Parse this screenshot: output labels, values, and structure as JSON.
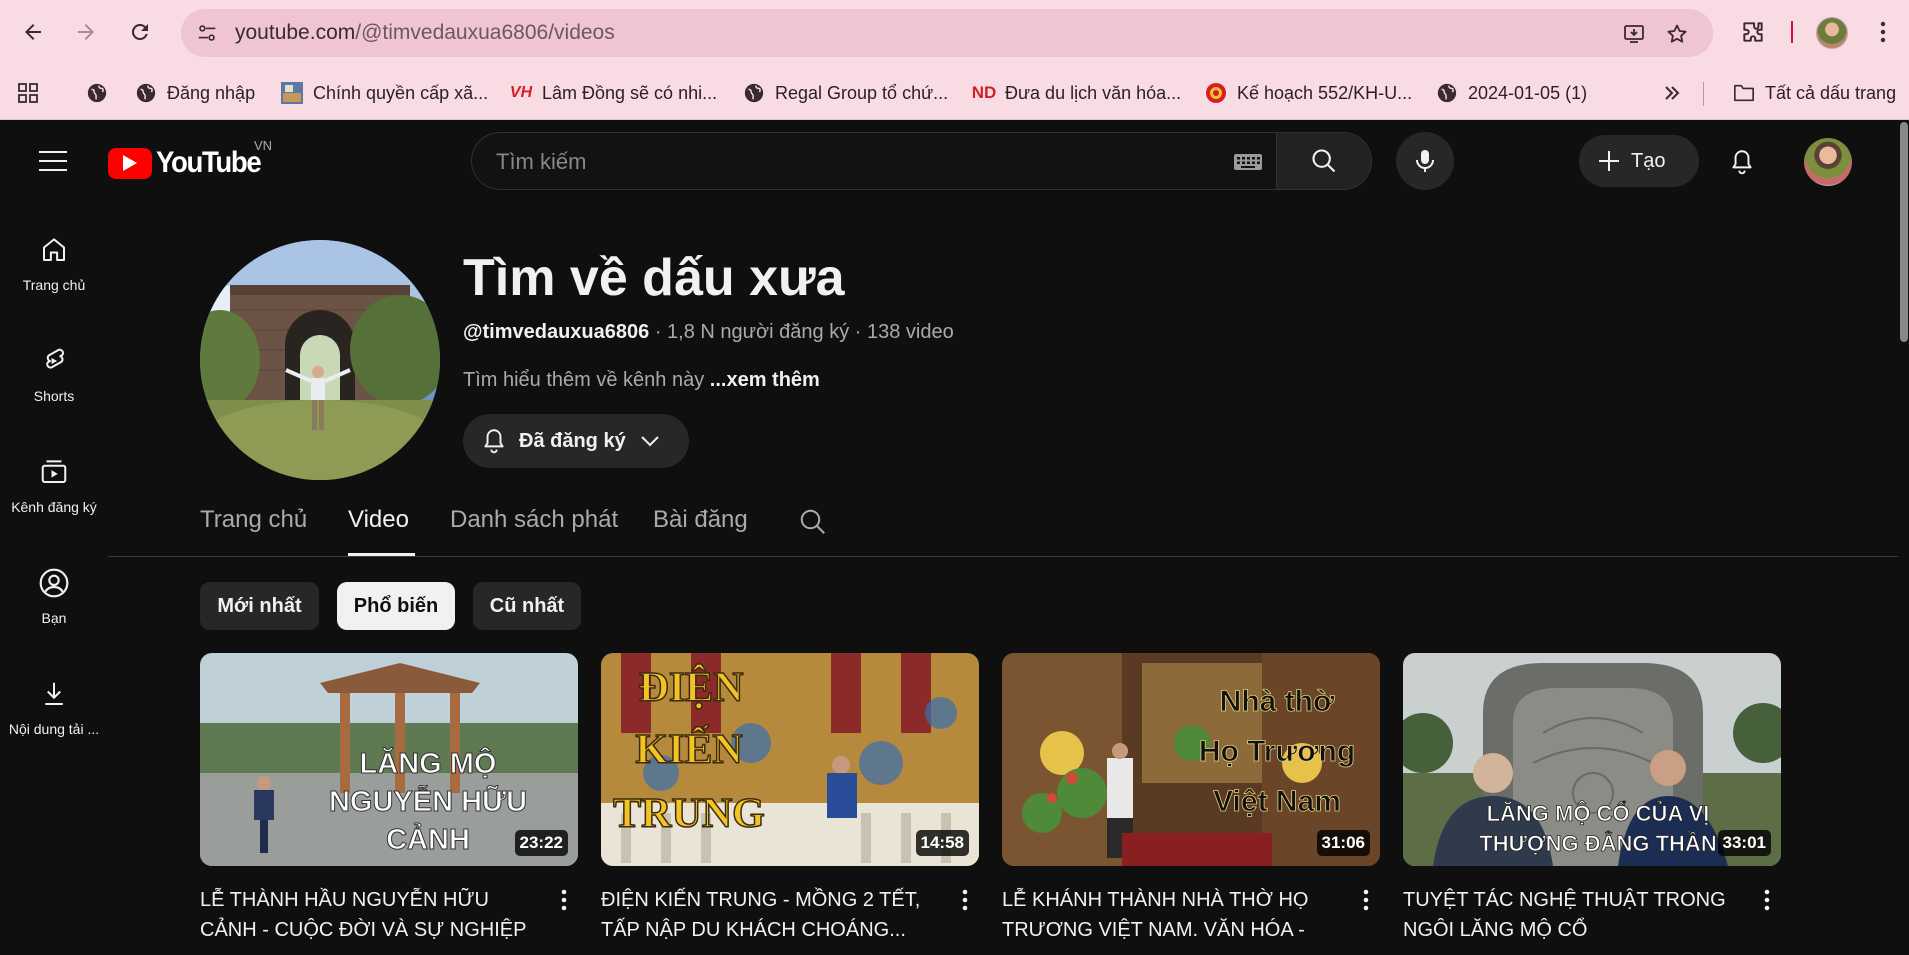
{
  "browser": {
    "url_host": "youtube.com",
    "url_path": "/@timvedauxua6806/videos",
    "bookmarks": [
      {
        "label": "",
        "icon": "globe-icon"
      },
      {
        "label": "Đăng nhập",
        "icon": "globe-icon"
      },
      {
        "label": "Chính quyền cấp xã...",
        "icon": "image-favicon-icon"
      },
      {
        "label": "Lâm Đồng sẽ có nhi...",
        "icon": "vh-favicon-icon"
      },
      {
        "label": "Regal Group tổ chứ...",
        "icon": "globe-icon"
      },
      {
        "label": "Đưa du lịch văn hóa...",
        "icon": "nd-favicon-icon"
      },
      {
        "label": "Kế hoạch 552/KH-U...",
        "icon": "emblem-favicon-icon"
      },
      {
        "label": "2024-01-05 (1)",
        "icon": "globe-icon"
      }
    ],
    "all_bookmarks_label": "Tất cả dấu trang",
    "accent_color": "#f8dbe3"
  },
  "yt": {
    "region": "VN",
    "logo_text": "YouTube",
    "search_placeholder": "Tìm kiếm",
    "create_label": "Tạo"
  },
  "guide": [
    {
      "label": "Trang chủ",
      "icon": "home-icon"
    },
    {
      "label": "Shorts",
      "icon": "shorts-icon"
    },
    {
      "label": "Kênh đăng ký",
      "icon": "subscriptions-icon"
    },
    {
      "label": "Bạn",
      "icon": "you-icon"
    },
    {
      "label": "Nội dung tải ...",
      "icon": "download-icon"
    }
  ],
  "channel": {
    "title": "Tìm về dấu xưa",
    "handle": "@timvedauxua6806",
    "stats": " · 1,8 N người đăng ký · 138 video",
    "description": "Tìm hiểu thêm về kênh này ",
    "more": "...xem thêm",
    "subscribe_label": "Đã đăng ký"
  },
  "tabs": [
    "Trang chủ",
    "Video",
    "Danh sách phát",
    "Bài đăng"
  ],
  "active_tab": "Video",
  "chips": [
    "Mới nhất",
    "Phổ biến",
    "Cũ nhất"
  ],
  "active_chip": "Phổ biến",
  "videos": [
    {
      "title": "LỄ THÀNH HẦU NGUYỄN HỮU CẢNH - CUỘC ĐỜI VÀ SỰ NGHIỆP",
      "duration": "23:22",
      "thumb_text": [
        "LĂNG MỘ",
        "NGUYỄN HỮU",
        "CẢNH"
      ]
    },
    {
      "title": "ĐIỆN KIẾN TRUNG - MỒNG 2 TẾT, TẤP NẬP DU KHÁCH CHOÁNG...",
      "duration": "14:58",
      "thumb_text": [
        "ĐIỆN",
        "KIẾN",
        "TRUNG"
      ]
    },
    {
      "title": "LỄ KHÁNH THÀNH NHÀ THỜ HỌ TRƯƠNG VIỆT NAM. VĂN HÓA - DI...",
      "duration": "31:06",
      "thumb_text": [
        "Nhà thờ",
        "Họ Trương",
        "Việt Nam"
      ]
    },
    {
      "title": "TUYỆT TÁC NGHỆ THUẬT TRONG NGÔI LĂNG MỘ CỔ",
      "duration": "33:01",
      "thumb_text": [
        "LĂNG MỘ CỔ CỦA VỊ",
        "THƯỢNG ĐẲNG THẦN"
      ]
    }
  ]
}
